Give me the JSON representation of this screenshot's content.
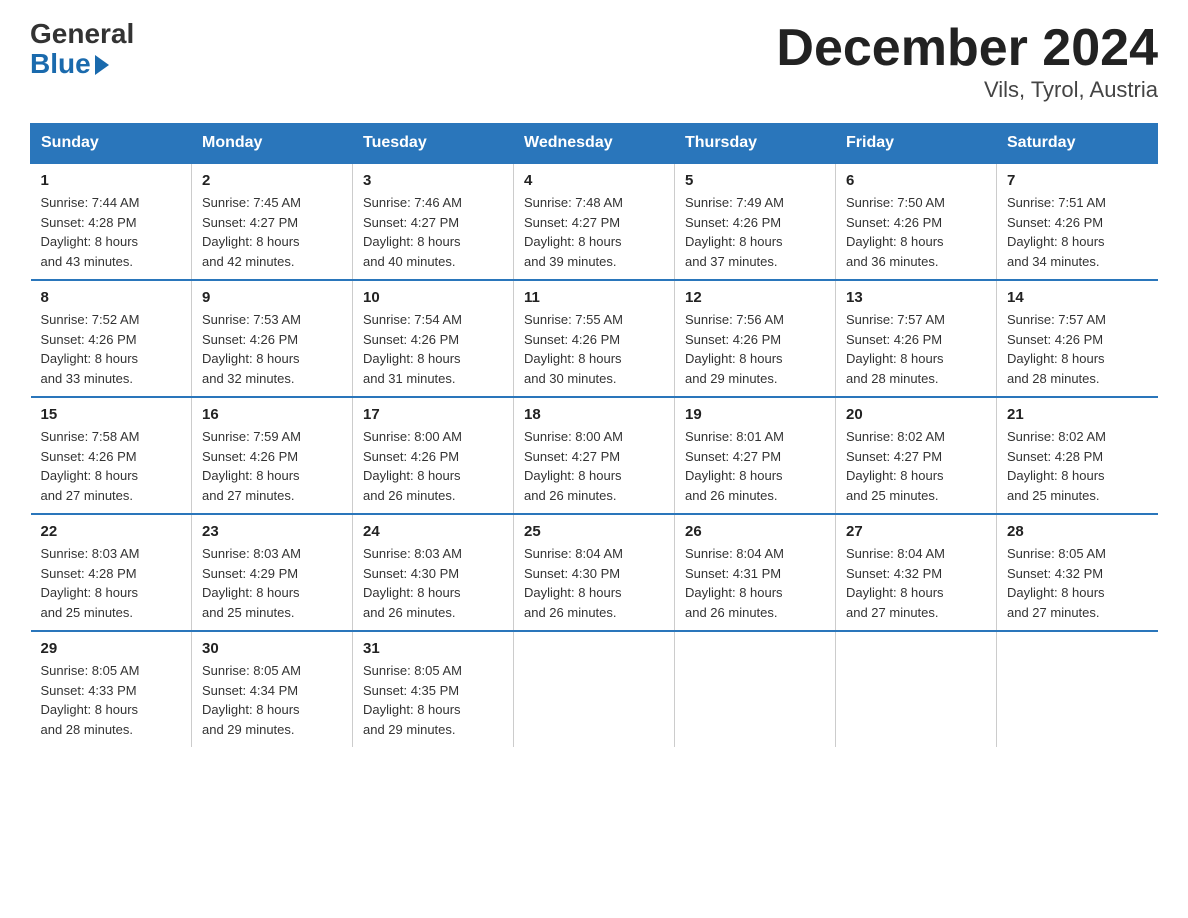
{
  "logo": {
    "general": "General",
    "blue": "Blue"
  },
  "title": "December 2024",
  "subtitle": "Vils, Tyrol, Austria",
  "days_of_week": [
    "Sunday",
    "Monday",
    "Tuesday",
    "Wednesday",
    "Thursday",
    "Friday",
    "Saturday"
  ],
  "weeks": [
    [
      {
        "day": "1",
        "sunrise": "7:44 AM",
        "sunset": "4:28 PM",
        "daylight": "8 hours and 43 minutes."
      },
      {
        "day": "2",
        "sunrise": "7:45 AM",
        "sunset": "4:27 PM",
        "daylight": "8 hours and 42 minutes."
      },
      {
        "day": "3",
        "sunrise": "7:46 AM",
        "sunset": "4:27 PM",
        "daylight": "8 hours and 40 minutes."
      },
      {
        "day": "4",
        "sunrise": "7:48 AM",
        "sunset": "4:27 PM",
        "daylight": "8 hours and 39 minutes."
      },
      {
        "day": "5",
        "sunrise": "7:49 AM",
        "sunset": "4:26 PM",
        "daylight": "8 hours and 37 minutes."
      },
      {
        "day": "6",
        "sunrise": "7:50 AM",
        "sunset": "4:26 PM",
        "daylight": "8 hours and 36 minutes."
      },
      {
        "day": "7",
        "sunrise": "7:51 AM",
        "sunset": "4:26 PM",
        "daylight": "8 hours and 34 minutes."
      }
    ],
    [
      {
        "day": "8",
        "sunrise": "7:52 AM",
        "sunset": "4:26 PM",
        "daylight": "8 hours and 33 minutes."
      },
      {
        "day": "9",
        "sunrise": "7:53 AM",
        "sunset": "4:26 PM",
        "daylight": "8 hours and 32 minutes."
      },
      {
        "day": "10",
        "sunrise": "7:54 AM",
        "sunset": "4:26 PM",
        "daylight": "8 hours and 31 minutes."
      },
      {
        "day": "11",
        "sunrise": "7:55 AM",
        "sunset": "4:26 PM",
        "daylight": "8 hours and 30 minutes."
      },
      {
        "day": "12",
        "sunrise": "7:56 AM",
        "sunset": "4:26 PM",
        "daylight": "8 hours and 29 minutes."
      },
      {
        "day": "13",
        "sunrise": "7:57 AM",
        "sunset": "4:26 PM",
        "daylight": "8 hours and 28 minutes."
      },
      {
        "day": "14",
        "sunrise": "7:57 AM",
        "sunset": "4:26 PM",
        "daylight": "8 hours and 28 minutes."
      }
    ],
    [
      {
        "day": "15",
        "sunrise": "7:58 AM",
        "sunset": "4:26 PM",
        "daylight": "8 hours and 27 minutes."
      },
      {
        "day": "16",
        "sunrise": "7:59 AM",
        "sunset": "4:26 PM",
        "daylight": "8 hours and 27 minutes."
      },
      {
        "day": "17",
        "sunrise": "8:00 AM",
        "sunset": "4:26 PM",
        "daylight": "8 hours and 26 minutes."
      },
      {
        "day": "18",
        "sunrise": "8:00 AM",
        "sunset": "4:27 PM",
        "daylight": "8 hours and 26 minutes."
      },
      {
        "day": "19",
        "sunrise": "8:01 AM",
        "sunset": "4:27 PM",
        "daylight": "8 hours and 26 minutes."
      },
      {
        "day": "20",
        "sunrise": "8:02 AM",
        "sunset": "4:27 PM",
        "daylight": "8 hours and 25 minutes."
      },
      {
        "day": "21",
        "sunrise": "8:02 AM",
        "sunset": "4:28 PM",
        "daylight": "8 hours and 25 minutes."
      }
    ],
    [
      {
        "day": "22",
        "sunrise": "8:03 AM",
        "sunset": "4:28 PM",
        "daylight": "8 hours and 25 minutes."
      },
      {
        "day": "23",
        "sunrise": "8:03 AM",
        "sunset": "4:29 PM",
        "daylight": "8 hours and 25 minutes."
      },
      {
        "day": "24",
        "sunrise": "8:03 AM",
        "sunset": "4:30 PM",
        "daylight": "8 hours and 26 minutes."
      },
      {
        "day": "25",
        "sunrise": "8:04 AM",
        "sunset": "4:30 PM",
        "daylight": "8 hours and 26 minutes."
      },
      {
        "day": "26",
        "sunrise": "8:04 AM",
        "sunset": "4:31 PM",
        "daylight": "8 hours and 26 minutes."
      },
      {
        "day": "27",
        "sunrise": "8:04 AM",
        "sunset": "4:32 PM",
        "daylight": "8 hours and 27 minutes."
      },
      {
        "day": "28",
        "sunrise": "8:05 AM",
        "sunset": "4:32 PM",
        "daylight": "8 hours and 27 minutes."
      }
    ],
    [
      {
        "day": "29",
        "sunrise": "8:05 AM",
        "sunset": "4:33 PM",
        "daylight": "8 hours and 28 minutes."
      },
      {
        "day": "30",
        "sunrise": "8:05 AM",
        "sunset": "4:34 PM",
        "daylight": "8 hours and 29 minutes."
      },
      {
        "day": "31",
        "sunrise": "8:05 AM",
        "sunset": "4:35 PM",
        "daylight": "8 hours and 29 minutes."
      },
      null,
      null,
      null,
      null
    ]
  ],
  "labels": {
    "sunrise": "Sunrise: ",
    "sunset": "Sunset: ",
    "daylight": "Daylight: "
  }
}
